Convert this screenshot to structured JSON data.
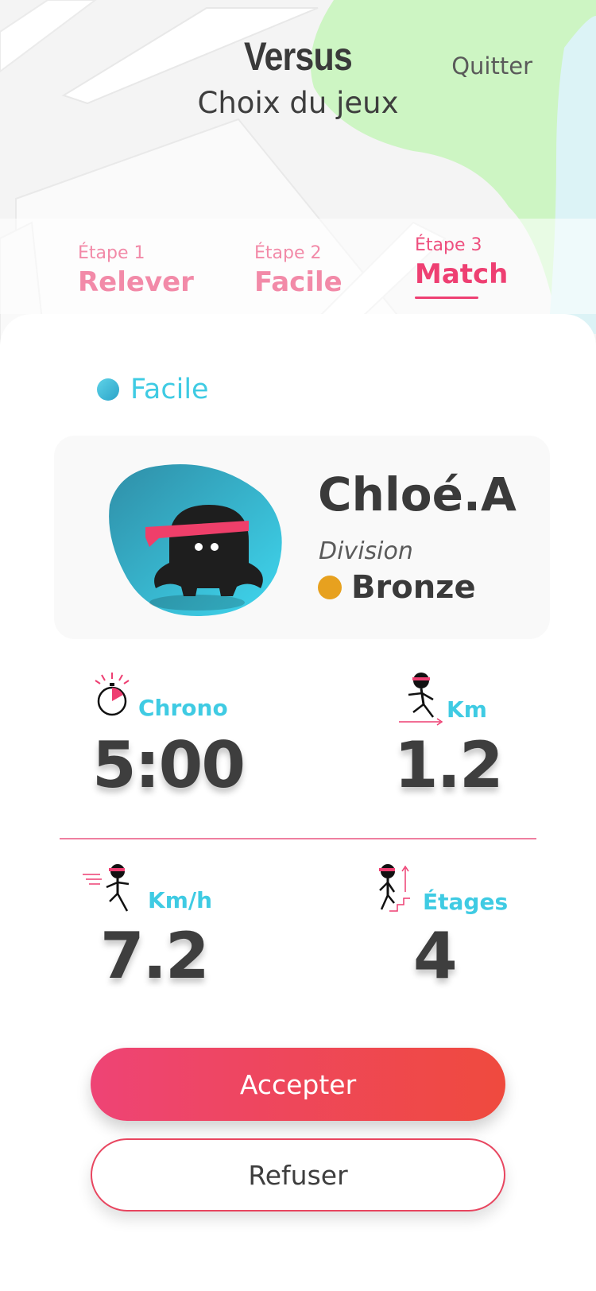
{
  "header": {
    "title": "Versus",
    "subtitle": "Choix du jeux",
    "quit_label": "Quitter"
  },
  "steps": [
    {
      "label": "Étape 1",
      "value": "Relever",
      "active": false
    },
    {
      "label": "Étape 2",
      "value": "Facile",
      "active": false
    },
    {
      "label": "Étape 3",
      "value": "Match",
      "active": true
    }
  ],
  "level": {
    "label": "Facile"
  },
  "player": {
    "name": "Chloé.A",
    "division_label": "Division",
    "division": "Bronze"
  },
  "stats": {
    "chrono": {
      "label": "Chrono",
      "value": "5:00"
    },
    "km": {
      "label": "Km",
      "value": "1.2"
    },
    "kmh": {
      "label": "Km/h",
      "value": "7.2"
    },
    "floors": {
      "label": "Étages",
      "value": "4"
    }
  },
  "buttons": {
    "accept": "Accepter",
    "refuse": "Refuser"
  },
  "colors": {
    "accent_pink": "#ee3f72",
    "accent_cyan": "#3fcbe3",
    "bronze": "#e7a11f",
    "map_green": "#cdf5c3"
  },
  "icons": {
    "chrono": "stopwatch-icon",
    "km": "runner-distance-icon",
    "kmh": "runner-speed-icon",
    "floors": "runner-stairs-icon",
    "avatar": "ninja-avatar"
  }
}
